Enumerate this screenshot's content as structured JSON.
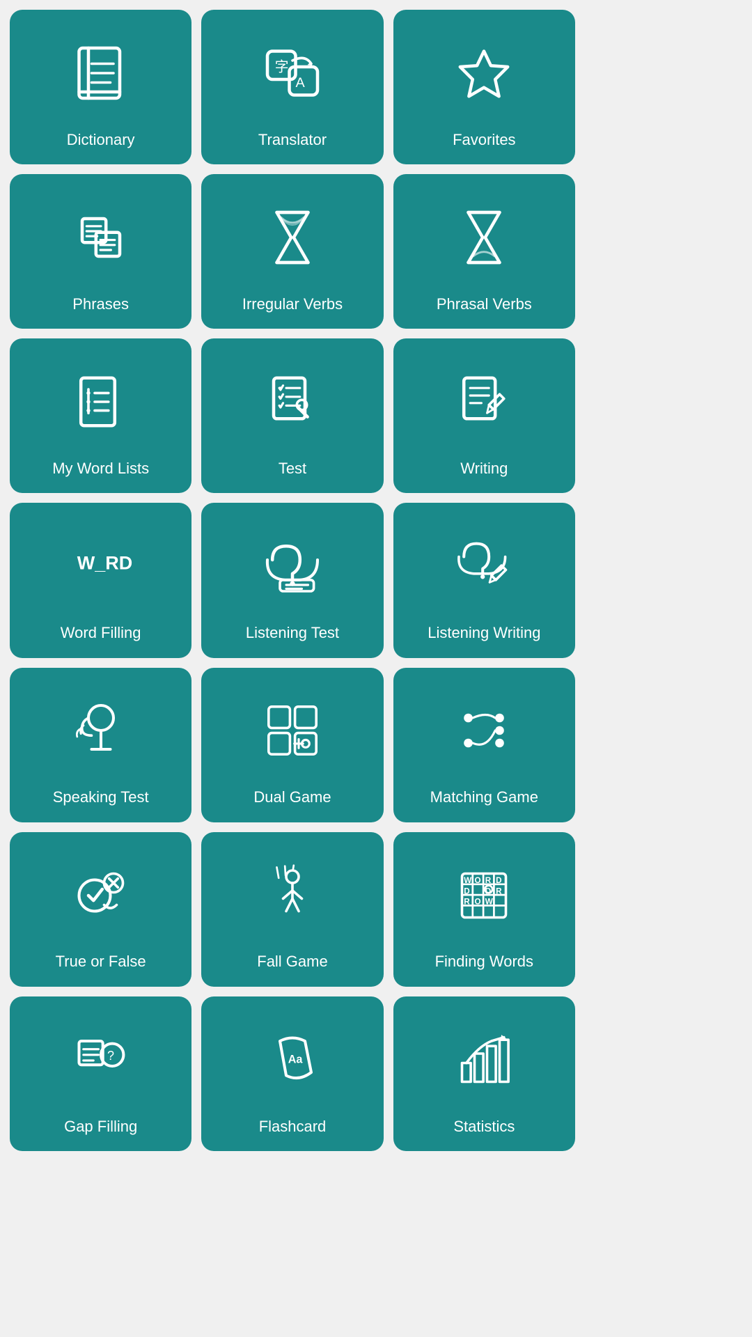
{
  "cards": [
    {
      "id": "dictionary",
      "label": "Dictionary",
      "icon": "dictionary"
    },
    {
      "id": "translator",
      "label": "Translator",
      "icon": "translator"
    },
    {
      "id": "favorites",
      "label": "Favorites",
      "icon": "favorites"
    },
    {
      "id": "phrases",
      "label": "Phrases",
      "icon": "phrases"
    },
    {
      "id": "irregular-verbs",
      "label": "Irregular Verbs",
      "icon": "hourglass"
    },
    {
      "id": "phrasal-verbs",
      "label": "Phrasal Verbs",
      "icon": "hourglass2"
    },
    {
      "id": "my-word-lists",
      "label": "My Word Lists",
      "icon": "wordlists"
    },
    {
      "id": "test",
      "label": "Test",
      "icon": "test"
    },
    {
      "id": "writing",
      "label": "Writing",
      "icon": "writing"
    },
    {
      "id": "word-filling",
      "label": "Word Filling",
      "icon": "wordfilling"
    },
    {
      "id": "listening-test",
      "label": "Listening Test",
      "icon": "listeningtest"
    },
    {
      "id": "listening-writing",
      "label": "Listening Writing",
      "icon": "listeningwriting"
    },
    {
      "id": "speaking-test",
      "label": "Speaking Test",
      "icon": "speakingtest"
    },
    {
      "id": "dual-game",
      "label": "Dual Game",
      "icon": "dualgame"
    },
    {
      "id": "matching-game",
      "label": "Matching Game",
      "icon": "matchinggame"
    },
    {
      "id": "true-or-false",
      "label": "True or False",
      "icon": "trueorfalse"
    },
    {
      "id": "fall-game",
      "label": "Fall Game",
      "icon": "fallgame"
    },
    {
      "id": "finding-words",
      "label": "Finding Words",
      "icon": "findingwords"
    },
    {
      "id": "gap-filling",
      "label": "Gap Filling",
      "icon": "gapfilling"
    },
    {
      "id": "flashcard",
      "label": "Flashcard",
      "icon": "flashcard"
    },
    {
      "id": "statistics",
      "label": "Statistics",
      "icon": "statistics"
    }
  ]
}
